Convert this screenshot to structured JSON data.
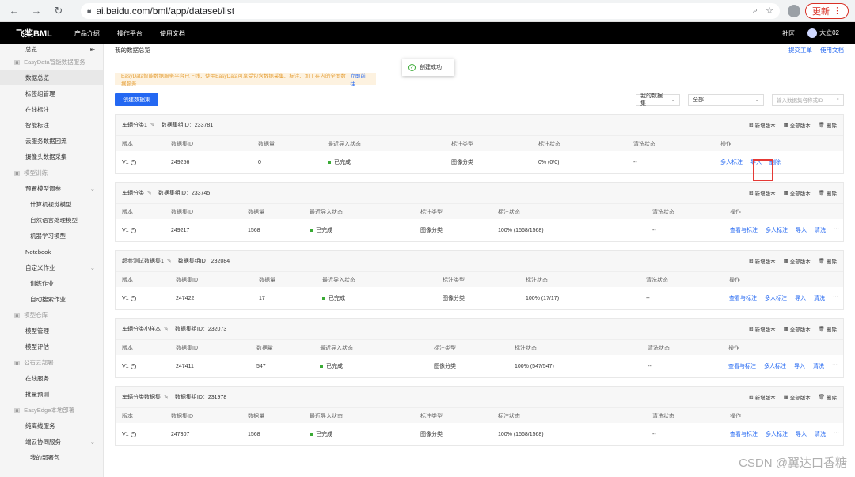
{
  "browser": {
    "url": "ai.baidu.com/bml/app/dataset/list",
    "update_label": "更新"
  },
  "topnav": {
    "logo": "飞桨BML",
    "items": [
      "产品介绍",
      "操作平台",
      "使用文档"
    ],
    "community": "社区",
    "user": "大立02"
  },
  "sidebar": {
    "top": "总览",
    "items": [
      {
        "type": "group",
        "label": "EasyData智能数据服务"
      },
      {
        "type": "item",
        "label": "数据总览",
        "active": true
      },
      {
        "type": "item",
        "label": "标签组管理"
      },
      {
        "type": "item",
        "label": "在线标注"
      },
      {
        "type": "item",
        "label": "智能标注"
      },
      {
        "type": "item",
        "label": "云服务数据回流"
      },
      {
        "type": "item",
        "label": "摄像头数据采集"
      },
      {
        "type": "group",
        "label": "模型训练"
      },
      {
        "type": "item",
        "label": "预置模型调参",
        "chevron": true
      },
      {
        "type": "sub",
        "label": "计算机视觉模型"
      },
      {
        "type": "sub",
        "label": "自然语言处理模型"
      },
      {
        "type": "sub",
        "label": "机器学习模型"
      },
      {
        "type": "item",
        "label": "Notebook"
      },
      {
        "type": "item",
        "label": "自定义作业",
        "chevron": true
      },
      {
        "type": "sub",
        "label": "训练作业"
      },
      {
        "type": "sub",
        "label": "自动搜索作业"
      },
      {
        "type": "group",
        "label": "模型仓库"
      },
      {
        "type": "item",
        "label": "模型管理"
      },
      {
        "type": "item",
        "label": "模型评估"
      },
      {
        "type": "group",
        "label": "公有云部署"
      },
      {
        "type": "item",
        "label": "在线服务"
      },
      {
        "type": "item",
        "label": "批量预测"
      },
      {
        "type": "group",
        "label": "EasyEdge本地部署"
      },
      {
        "type": "item",
        "label": "纯离线服务"
      },
      {
        "type": "item",
        "label": "端云协同服务",
        "chevron": true
      },
      {
        "type": "sub",
        "label": "我的部署包"
      }
    ]
  },
  "page": {
    "title": "我的数据总览",
    "links": [
      "提交工单",
      "使用文档"
    ],
    "banner": "EasyData智能数据服务平台已上线，使用EasyData可享受包含数据采集、标注、加工在内的全面数据服务",
    "banner_link": "立即前往",
    "create_button": "创建数据集",
    "filter_owner": "我的数据集",
    "filter_type": "全部",
    "search_placeholder": "输入数据集名称或ID"
  },
  "toast": "创建成功",
  "card_actions": [
    "新增版本",
    "全部版本",
    "删除"
  ],
  "datasets": [
    {
      "name": "车辆分类1",
      "group_id_label": "数据集组ID：233781",
      "cols": [
        "版本",
        "数据集ID",
        "数据量",
        "最近导入状态",
        "标注类型",
        "标注状态",
        "清洗状态",
        "操作"
      ],
      "row": {
        "version": "V1",
        "id": "249256",
        "count": "0",
        "import_status": "已完成",
        "label_type": "图像分类",
        "label_status": "0% (0/0)",
        "clean": "--",
        "ops": [
          "多人标注",
          "导入",
          "删除"
        ]
      }
    },
    {
      "name": "车辆分类",
      "group_id_label": "数据集组ID：233745",
      "cols": [
        "版本",
        "数据集ID",
        "数据量",
        "最近导入状态",
        "标注类型",
        "标注状态",
        "清洗状态",
        "操作"
      ],
      "row": {
        "version": "V1",
        "id": "249217",
        "count": "1568",
        "import_status": "已完成",
        "label_type": "图像分类",
        "label_status": "100% (1568/1568)",
        "clean": "--",
        "ops": [
          "查看与标注",
          "多人标注",
          "导入",
          "清洗",
          "···"
        ]
      }
    },
    {
      "name": "超参测试数据集1",
      "group_id_label": "数据集组ID：232084",
      "cols": [
        "版本",
        "数据集ID",
        "数据量",
        "最近导入状态",
        "标注类型",
        "标注状态",
        "清洗状态",
        "操作"
      ],
      "row": {
        "version": "V1",
        "id": "247422",
        "count": "17",
        "import_status": "已完成",
        "label_type": "图像分类",
        "label_status": "100% (17/17)",
        "clean": "--",
        "ops": [
          "查看与标注",
          "多人标注",
          "导入",
          "清洗",
          "···"
        ]
      }
    },
    {
      "name": "车辆分类小样本",
      "group_id_label": "数据集组ID：232073",
      "cols": [
        "版本",
        "数据集ID",
        "数据量",
        "最近导入状态",
        "标注类型",
        "标注状态",
        "清洗状态",
        "操作"
      ],
      "row": {
        "version": "V1",
        "id": "247411",
        "count": "547",
        "import_status": "已完成",
        "label_type": "图像分类",
        "label_status": "100% (547/547)",
        "clean": "--",
        "ops": [
          "查看与标注",
          "多人标注",
          "导入",
          "清洗",
          "···"
        ]
      }
    },
    {
      "name": "车辆分类数据集",
      "group_id_label": "数据集组ID：231978",
      "cols": [
        "版本",
        "数据集ID",
        "数据量",
        "最近导入状态",
        "标注类型",
        "标注状态",
        "清洗状态",
        "操作"
      ],
      "row": {
        "version": "V1",
        "id": "247307",
        "count": "1568",
        "import_status": "已完成",
        "label_type": "图像分类",
        "label_status": "100% (1568/1568)",
        "clean": "--",
        "ops": [
          "查看与标注",
          "多人标注",
          "导入",
          "清洗",
          "···"
        ]
      }
    }
  ],
  "watermark": "CSDN @翼达口香糖"
}
